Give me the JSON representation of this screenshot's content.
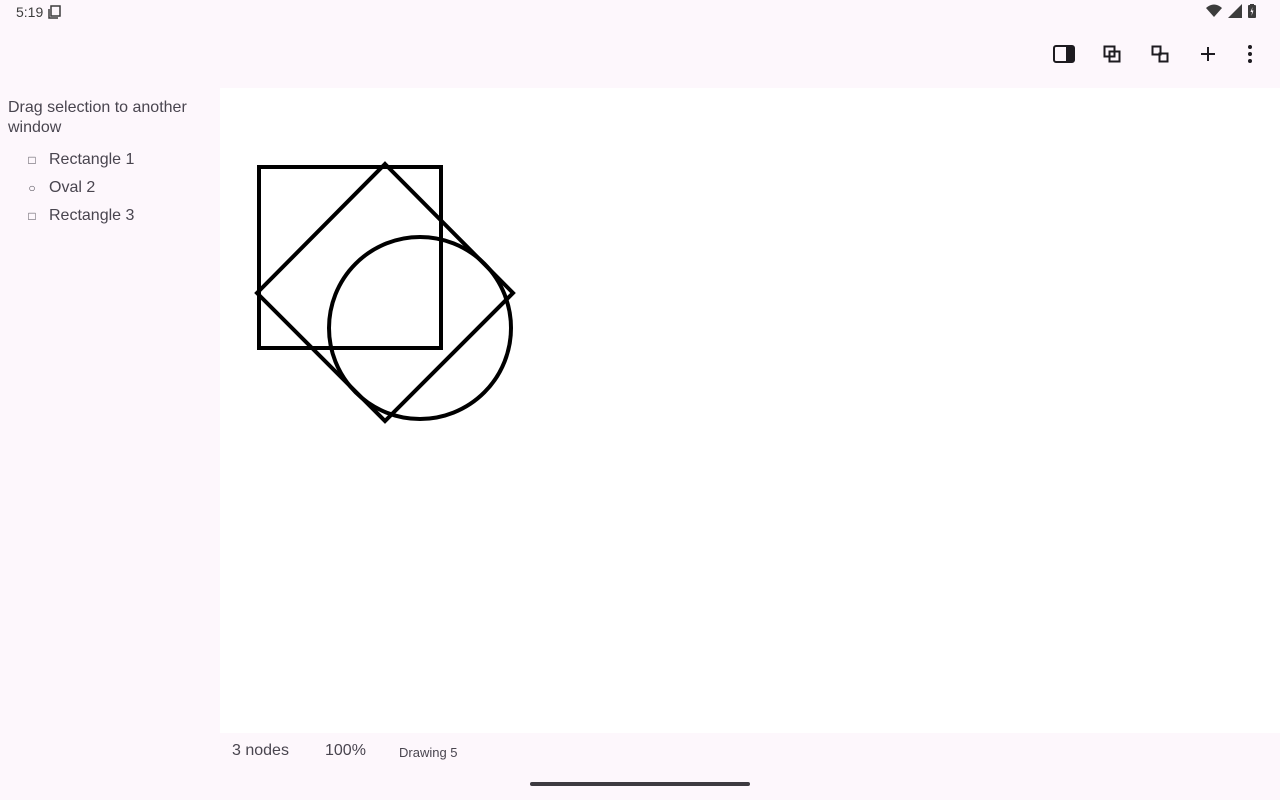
{
  "status_bar": {
    "time": "5:19",
    "icons": [
      "screen-icon",
      "wifi-icon",
      "signal-icon",
      "battery-icon"
    ]
  },
  "toolbar": {
    "buttons": [
      {
        "name": "toggle-panel-button",
        "icon": "side-panel-icon"
      },
      {
        "name": "group-button",
        "icon": "group-icon"
      },
      {
        "name": "ungroup-button",
        "icon": "ungroup-icon"
      },
      {
        "name": "add-button",
        "icon": "plus-icon"
      },
      {
        "name": "more-options-button",
        "icon": "more-vert-icon"
      }
    ]
  },
  "sidebar": {
    "hint": "Drag selection to another window",
    "nodes": [
      {
        "label": "Rectangle 1",
        "glyph": "□",
        "shape": "rectangle"
      },
      {
        "label": "Oval 2",
        "glyph": "○",
        "shape": "oval"
      },
      {
        "label": "Rectangle 3",
        "glyph": "□",
        "shape": "rectangle"
      }
    ]
  },
  "canvas": {
    "stroke_color": "#000000",
    "background": "#ffffff"
  },
  "status": {
    "node_count": "3 nodes",
    "zoom": "100%",
    "drawing_name": "Drawing 5"
  },
  "colors": {
    "surface": "#fdf7fc",
    "canvas": "#ffffff",
    "text": "#49454f"
  }
}
